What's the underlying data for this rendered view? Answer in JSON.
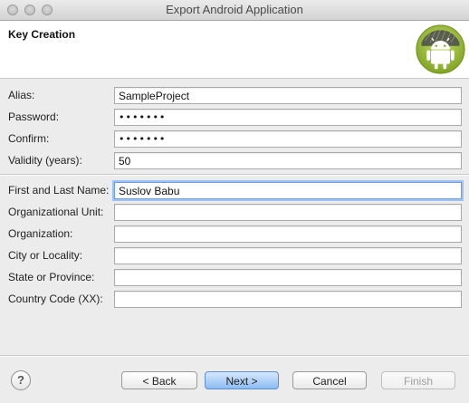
{
  "window": {
    "title": "Export Android Application"
  },
  "header": {
    "title": "Key Creation",
    "logo_icon": "android-logo-icon"
  },
  "form": {
    "alias": {
      "label": "Alias:",
      "value": "SampleProject"
    },
    "password": {
      "label": "Password:",
      "value": "•••••••"
    },
    "confirm": {
      "label": "Confirm:",
      "value": "•••••••"
    },
    "validity": {
      "label": "Validity (years):",
      "value": "50"
    },
    "name": {
      "label": "First and Last Name:",
      "value": "Suslov Babu"
    },
    "org_unit": {
      "label": "Organizational Unit:",
      "value": ""
    },
    "organization": {
      "label": "Organization:",
      "value": ""
    },
    "city": {
      "label": "City or Locality:",
      "value": ""
    },
    "state": {
      "label": "State or Province:",
      "value": ""
    },
    "country": {
      "label": "Country Code (XX):",
      "value": ""
    }
  },
  "buttons": {
    "help": "?",
    "back": "< Back",
    "next": "Next >",
    "cancel": "Cancel",
    "finish": "Finish"
  },
  "colors": {
    "android_green": "#a4c639",
    "focus_ring": "#9fc2f5",
    "default_button": "#8dbcf2"
  }
}
